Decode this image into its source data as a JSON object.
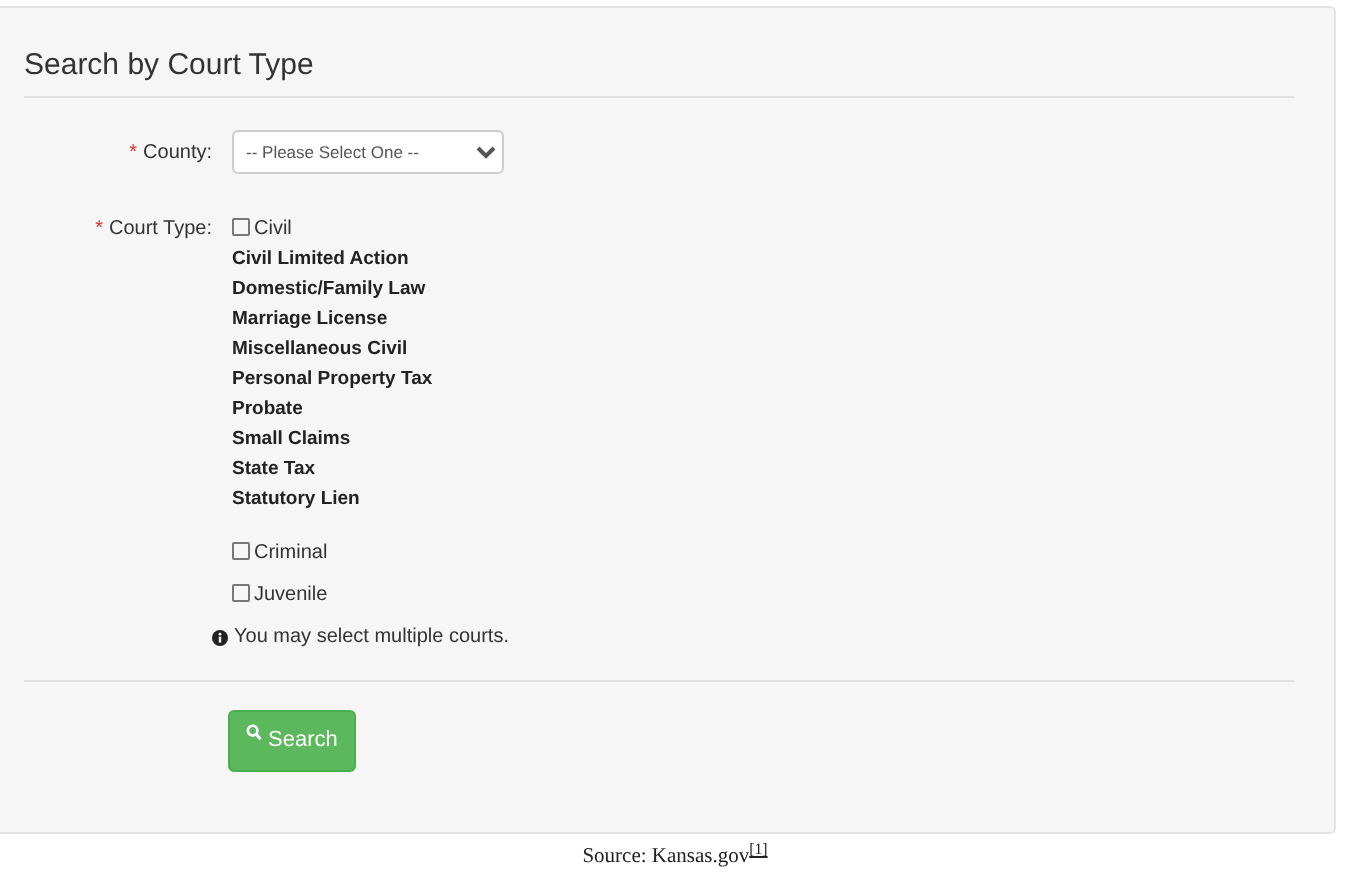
{
  "panel": {
    "title": "Search by Court Type"
  },
  "county": {
    "label": "County:",
    "required_mark": "*",
    "value": "-- Please Select One --"
  },
  "court_type": {
    "label": "Court Type:",
    "required_mark": "*",
    "options": [
      {
        "label": "Civil",
        "checked": false,
        "children": [
          {
            "label": "Civil Limited Action"
          },
          {
            "label": "Domestic/Family Law"
          },
          {
            "label": "Marriage License"
          },
          {
            "label": "Miscellaneous Civil"
          },
          {
            "label": "Personal Property Tax"
          },
          {
            "label": "Probate"
          },
          {
            "label": "Small Claims"
          },
          {
            "label": "State Tax"
          },
          {
            "label": "Statutory Lien"
          }
        ]
      },
      {
        "label": "Criminal",
        "checked": false
      },
      {
        "label": "Juvenile",
        "checked": false
      }
    ],
    "hint": "You may select multiple courts."
  },
  "search_button": "Search",
  "caption": {
    "text": "Source: Kansas.gov",
    "footnote": "[1]"
  }
}
